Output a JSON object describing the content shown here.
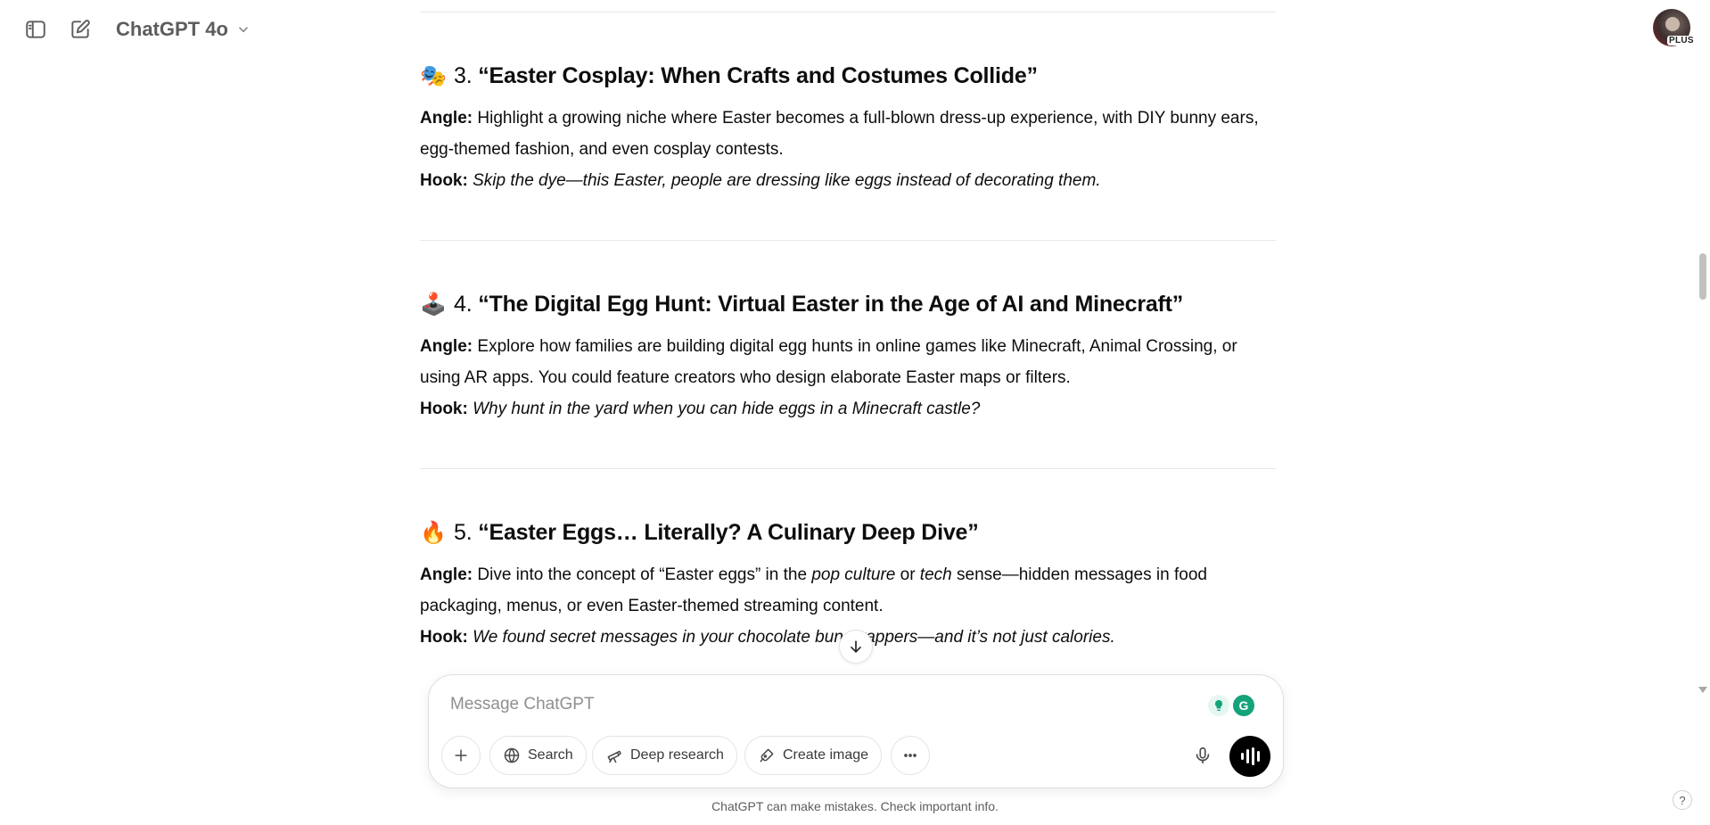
{
  "header": {
    "model_label": "ChatGPT 4o",
    "avatar_badge": "PLUS"
  },
  "sections": [
    {
      "emoji": "🎭",
      "number": "3.",
      "title": "“Easter Cosplay: When Crafts and Costumes Collide”",
      "angle_label": "Angle:",
      "angle_text": "Highlight a growing niche where Easter becomes a full-blown dress-up experience, with DIY bunny ears, egg-themed fashion, and even cosplay contests.",
      "hook_label": "Hook:",
      "hook_text": "Skip the dye—this Easter, people are dressing like eggs instead of decorating them."
    },
    {
      "emoji": "🕹️",
      "number": "4.",
      "title": "“The Digital Egg Hunt: Virtual Easter in the Age of AI and Minecraft”",
      "angle_label": "Angle:",
      "angle_text": "Explore how families are building digital egg hunts in online games like Minecraft, Animal Crossing, or using AR apps. You could feature creators who design elaborate Easter maps or filters.",
      "hook_label": "Hook:",
      "hook_text": "Why hunt in the yard when you can hide eggs in a Minecraft castle?"
    },
    {
      "emoji": "🔥",
      "number": "5.",
      "title": "“Easter Eggs… Literally? A Culinary Deep Dive”",
      "angle_label": "Angle:",
      "angle_parts": [
        "Dive into the concept of “Easter eggs” in the ",
        "pop culture",
        " or ",
        "tech",
        " sense—hidden messages in food packaging, menus, or even Easter-themed streaming content."
      ],
      "hook_label": "Hook:",
      "hook_text": "We found secret messages in your chocolate bun   wrappers—and it’s not just calories."
    }
  ],
  "composer": {
    "placeholder": "Message ChatGPT",
    "buttons": {
      "search": "Search",
      "deep_research": "Deep research",
      "create_image": "Create image"
    },
    "grammarly_letter": "G"
  },
  "disclaimer": "ChatGPT can make mistakes. Check important info.",
  "help_label": "?"
}
